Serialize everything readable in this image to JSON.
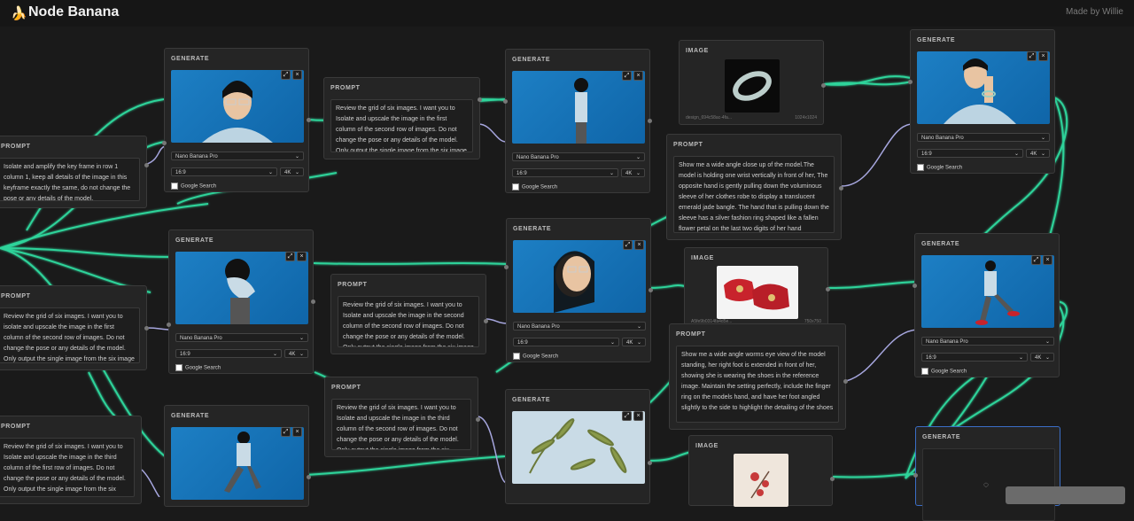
{
  "header": {
    "title": "Node Banana",
    "credit": "Made by Willie"
  },
  "labels": {
    "generate": "GENERATE",
    "prompt": "PROMPT",
    "image": "IMAGE"
  },
  "generate_options": {
    "model": "Nano Banana Pro",
    "aspect": "16:9",
    "resolution": "4K",
    "google_search": "Google Search"
  },
  "colors": {
    "edge_green": "#2ed39a",
    "edge_purple": "#a6a6de",
    "background": "#1a1a1a",
    "node": "#252525",
    "selected_border": "#3b6ec7"
  },
  "prompts": {
    "p1": "Isolate and amplify the key frame in row 1 column 1, keep all details of the image in this keyframe exactly the same, do not change the pose or any details of the model.",
    "p2": "Review the grid of six images. I want you to isolate and upscale the image in the first column of the second row of images. Do not change the pose or any details of the model. Only output the single image from the six image grid.",
    "p3": "Review the grid of six images. I want you to Isolate and upscale the image in the first column of the second row of images. Do not change the pose or any details of the model. Only output the single image from the six image grid.",
    "p4": "Review the grid of six images. I want you to Isolate and upscale the image in the second column of the second row of images. Do not change the pose or any details of the model. Only output the single image from the six image grid.",
    "p5": "Review the grid of six images. I want you to Isolate and upscale the image in the third column of the second row of images. Do not change the pose or any details of the model. Only output the single image from the six image grid.",
    "p6": "Review the grid of six images. I want you to Isolate and upscale the image in the third column of the first row of images. Do not change the pose or any details of the model. Only output the single image from the six image grid.",
    "p7": "Show me a wide angle close up of the model.The model is holding one wrist vertically in front of her, The opposite hand is gently pulling down the voluminous sleeve of her clothes robe to display a translucent emerald jade bangle. The hand that is pulling down the sleeve has a silver fashion ring shaped like a fallen flower petal on the last two digits of her hand encrusted into the front face.",
    "p8": "Show me a wide angle worms eye view of the model standing, her right foot is extended in front of her, showing she is wearing the shoes in the reference image. Maintain the setting perfectly, include the finger ring on the models hand, and have her foot angled slightly to the side to highlight the detailing of the shoes"
  },
  "images": {
    "img1": {
      "filename": "design_694c58ac-4fa...",
      "size": "1024x1024"
    },
    "img2": {
      "filename": "A5fe9b0314fa4d5e...",
      "size": "750x750"
    }
  },
  "icons": {
    "logo": "banana-icon",
    "expand": "expand-icon",
    "close": "close-icon",
    "chevron": "chevron-down-icon",
    "loading": "loading-spinner-icon"
  }
}
